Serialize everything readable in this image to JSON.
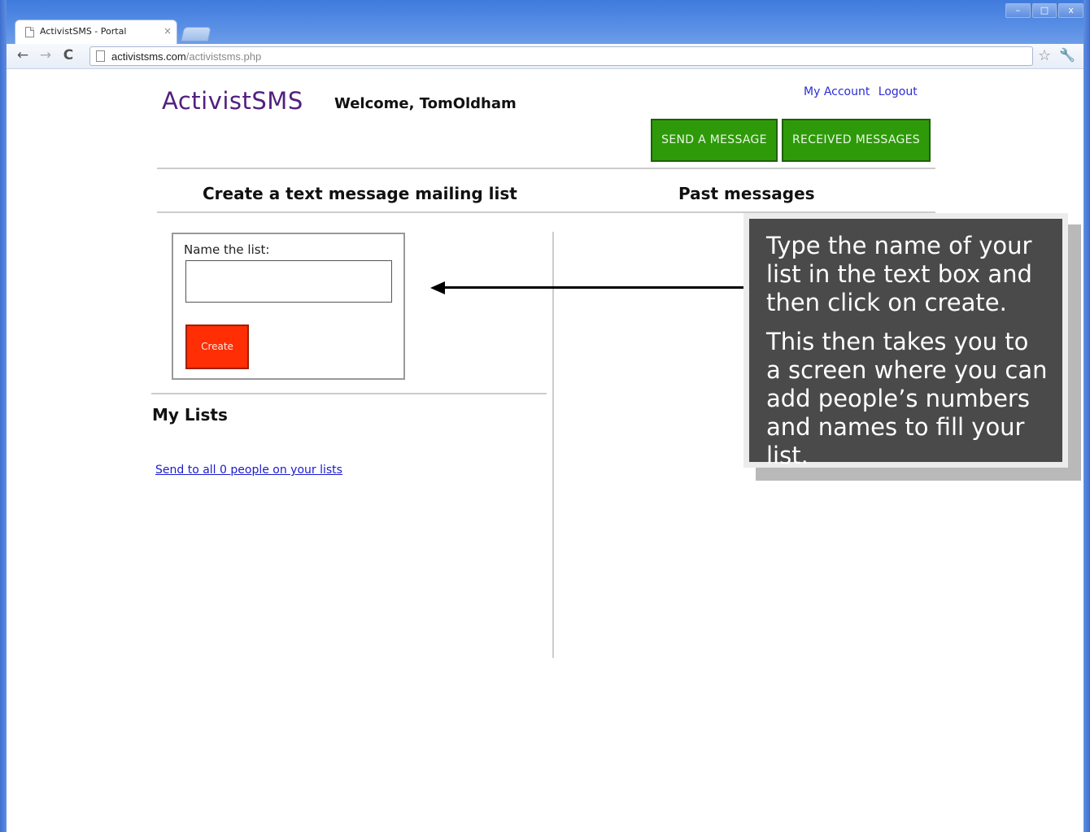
{
  "browser": {
    "tab_title": "ActivistSMS - Portal",
    "tab_close": "×",
    "window_controls": [
      "–",
      "□",
      "x"
    ],
    "url_domain": "activistsms.com",
    "url_path": "/activistsms.php"
  },
  "header": {
    "logo": "ActivistSMS",
    "welcome": "Welcome, TomOldham",
    "my_account": "My Account",
    "logout": "Logout",
    "send_message": "SEND A MESSAGE",
    "received_messages": "RECEIVED MESSAGES"
  },
  "create_section": {
    "heading": "Create a text message mailing list",
    "name_label": "Name the list:",
    "input_value": "",
    "create_button": "Create"
  },
  "past_section": {
    "heading": "Past messages"
  },
  "lists_section": {
    "heading": "My Lists",
    "send_all_link": "Send to all 0 people on your lists"
  },
  "callout": {
    "paragraph1": "Type the name of your list in the text box and then click on create.",
    "paragraph2": "This then takes you to a screen where you can add people’s numbers and names to fill your list."
  },
  "icons": {
    "back": "back-arrow-icon",
    "forward": "forward-arrow-icon",
    "reload": "reload-icon",
    "bookmark": "star-icon",
    "settings": "wrench-icon"
  }
}
